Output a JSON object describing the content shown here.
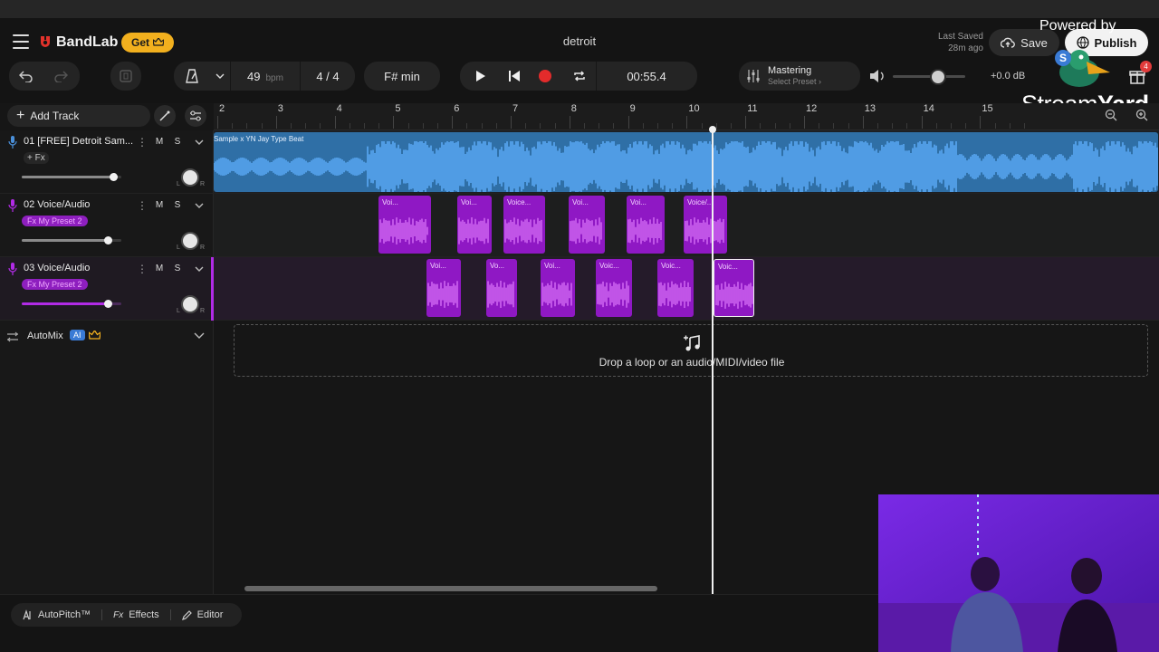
{
  "header": {
    "brand": "BandLab",
    "get_label": "Get",
    "project_title": "detroit",
    "last_saved_label": "Last Saved",
    "last_saved_time": "28m ago",
    "save_label": "Save",
    "publish_label": "Publish"
  },
  "overlay": {
    "powered_by": "Powered by",
    "streamyard_a": "Stream",
    "streamyard_b": "Yard",
    "avatar_letter": "S"
  },
  "toolbar": {
    "tempo": "49",
    "tempo_unit": "bpm",
    "time_signature": "4 / 4",
    "key": "F# min",
    "time": "00:55.4",
    "mastering_title": "Mastering",
    "mastering_sub": "Select Preset",
    "volume_db": "+0.0 dB",
    "volume_level": 0.62,
    "notification_count": "4"
  },
  "left": {
    "add_track_label": "Add Track",
    "automix_label": "AutoMix",
    "ai_badge": "AI"
  },
  "ruler": {
    "bars": [
      "2",
      "3",
      "4",
      "5",
      "6",
      "7",
      "8",
      "9",
      "10",
      "11",
      "12",
      "13",
      "14",
      "15"
    ]
  },
  "tracks": [
    {
      "name": "01  [FREE] Detroit Sam...",
      "fx": "+ Fx",
      "mute": "M",
      "solo": "S",
      "volume": 0.92,
      "pan_l": "L",
      "pan_r": "R",
      "clip_label": "Sample x YN Jay Type Beat"
    },
    {
      "name": "02  Voice/Audio",
      "fx": "Fx  My Preset 2",
      "mute": "M",
      "solo": "S",
      "volume": 0.87,
      "pan_l": "L",
      "pan_r": "R"
    },
    {
      "name": "03  Voice/Audio",
      "fx": "Fx  My Preset 2",
      "mute": "M",
      "solo": "S",
      "volume": 0.87,
      "pan_l": "L",
      "pan_r": "R"
    }
  ],
  "clips_track2": [
    "Voi...",
    "Voi...",
    "Voice...",
    "Voi...",
    "Voi...",
    "Voice/..."
  ],
  "clips_track3": [
    "Voi...",
    "Vo...",
    "Voi...",
    "Voic...",
    "Voic...",
    "Voic..."
  ],
  "drop_zone_text": "Drop a loop or an audio/MIDI/video file",
  "bottom": {
    "autopitch": "AutoPitch™",
    "effects": "Effects",
    "editor": "Editor"
  },
  "colors": {
    "accent_purple": "#8f18c4",
    "track1_blue": "#2f6fa6",
    "record_red": "#e32b2b",
    "get_yellow": "#f2b01e"
  }
}
